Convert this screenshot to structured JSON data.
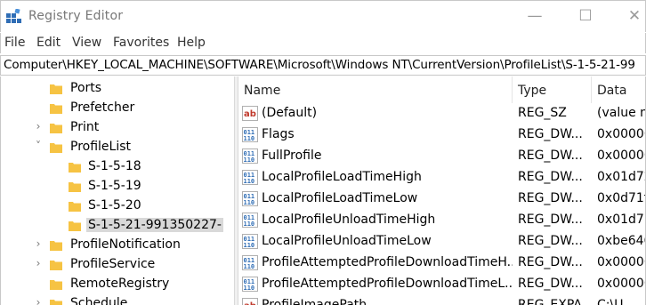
{
  "window": {
    "title": "Registry Editor",
    "controls": {
      "minimize": "—",
      "maximize": "☐",
      "close": "✕"
    }
  },
  "menu": [
    "File",
    "Edit",
    "View",
    "Favorites",
    "Help"
  ],
  "address": "Computer\\HKEY_LOCAL_MACHINE\\SOFTWARE\\Microsoft\\Windows NT\\CurrentVersion\\ProfileList\\S-1-5-21-99",
  "tree": {
    "items": [
      {
        "label": "Ports",
        "chevron": ""
      },
      {
        "label": "Prefetcher",
        "chevron": ""
      },
      {
        "label": "Print",
        "chevron": "›"
      },
      {
        "label": "ProfileList",
        "chevron": "˅"
      },
      {
        "label": "S-1-5-18",
        "chevron": ""
      },
      {
        "label": "S-1-5-19",
        "chevron": ""
      },
      {
        "label": "S-1-5-20",
        "chevron": ""
      },
      {
        "label": "S-1-5-21-991350227-",
        "chevron": ""
      },
      {
        "label": "ProfileNotification",
        "chevron": "›"
      },
      {
        "label": "ProfileService",
        "chevron": "›"
      },
      {
        "label": "RemoteRegistry",
        "chevron": ""
      },
      {
        "label": "Schedule",
        "chevron": "›"
      }
    ]
  },
  "values": {
    "columns": {
      "name": "Name",
      "type": "Type",
      "data": "Data"
    },
    "rows": [
      {
        "icon": "string-value-icon",
        "name": "(Default)",
        "type": "REG_SZ",
        "data": "(value n"
      },
      {
        "icon": "binary-value-icon",
        "name": "Flags",
        "type": "REG_DW...",
        "data": "0x00000"
      },
      {
        "icon": "binary-value-icon",
        "name": "FullProfile",
        "type": "REG_DW...",
        "data": "0x00000"
      },
      {
        "icon": "binary-value-icon",
        "name": "LocalProfileLoadTimeHigh",
        "type": "REG_DW...",
        "data": "0x01d72"
      },
      {
        "icon": "binary-value-icon",
        "name": "LocalProfileLoadTimeLow",
        "type": "REG_DW...",
        "data": "0x0d71f"
      },
      {
        "icon": "binary-value-icon",
        "name": "LocalProfileUnloadTimeHigh",
        "type": "REG_DW...",
        "data": "0x01d71"
      },
      {
        "icon": "binary-value-icon",
        "name": "LocalProfileUnloadTimeLow",
        "type": "REG_DW...",
        "data": "0xbe646"
      },
      {
        "icon": "binary-value-icon",
        "name": "ProfileAttemptedProfileDownloadTimeH...",
        "type": "REG_DW...",
        "data": "0x00000"
      },
      {
        "icon": "binary-value-icon",
        "name": "ProfileAttemptedProfileDownloadTimeL...",
        "type": "REG_DW...",
        "data": "0x00000"
      },
      {
        "icon": "string-value-icon",
        "name": "ProfileImagePath",
        "type": "REG_EXPA...",
        "data": "C:\\U"
      }
    ]
  },
  "colors": {
    "folder": "#f6c343",
    "selection": "#d9d9d9",
    "string_icon": "#c0392b",
    "binary_icon": "#2f6db5"
  }
}
